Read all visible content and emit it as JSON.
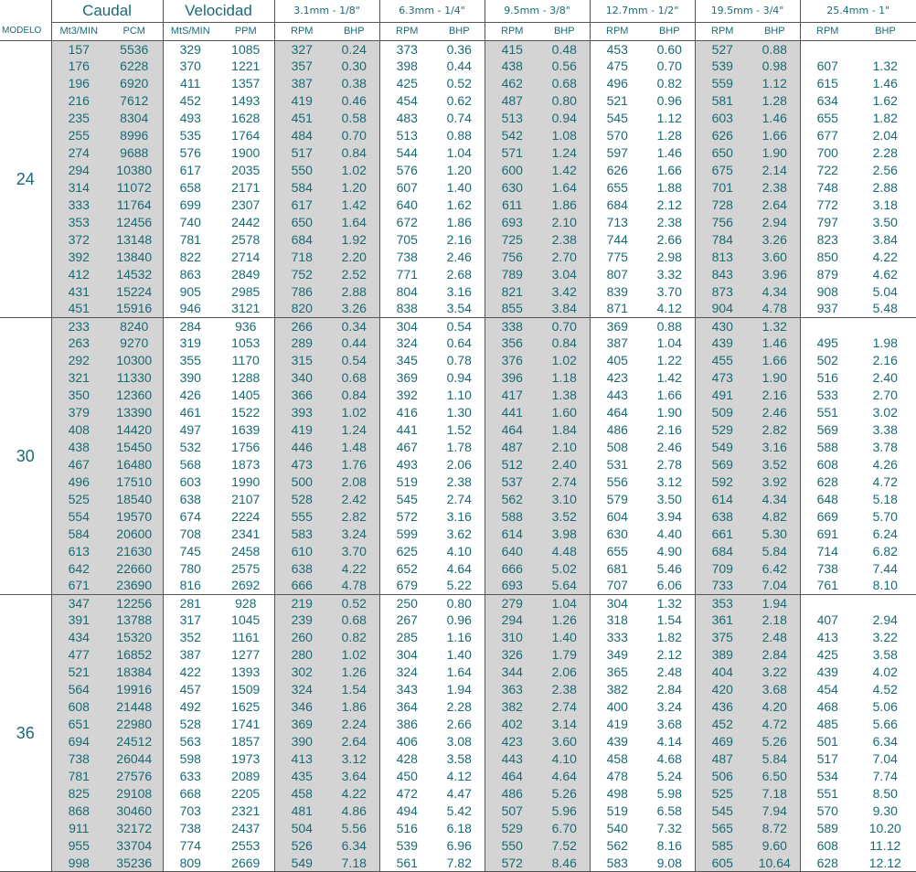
{
  "header": {
    "groups": [
      "Caudal",
      "Velocidad",
      "3.1mm - 1/8\"",
      "6.3mm - 1/4\"",
      "9.5mm - 3/8\"",
      "12.7mm - 1/2\"",
      "19.5mm - 3/4\"",
      "25.4mm - 1\""
    ],
    "modelo_label": "MODELO",
    "subheaders": [
      "Mt3/MIN",
      "PCM",
      "MtS/MIN",
      "PPM",
      "RPM",
      "BHP",
      "RPM",
      "BHP",
      "RPM",
      "BHP",
      "RPM",
      "BHP",
      "RPM",
      "BHP",
      "RPM",
      "BHP"
    ]
  },
  "models": [
    {
      "label": "24",
      "rows": [
        [
          "157",
          "5536",
          "329",
          "1085",
          "327",
          "0.24",
          "373",
          "0.36",
          "415",
          "0.48",
          "453",
          "0.60",
          "527",
          "0.88",
          "",
          ""
        ],
        [
          "176",
          "6228",
          "370",
          "1221",
          "357",
          "0.30",
          "398",
          "0.44",
          "438",
          "0.56",
          "475",
          "0.70",
          "539",
          "0.98",
          "607",
          "1.32"
        ],
        [
          "196",
          "6920",
          "411",
          "1357",
          "387",
          "0.38",
          "425",
          "0.52",
          "462",
          "0.68",
          "496",
          "0.82",
          "559",
          "1.12",
          "615",
          "1.46"
        ],
        [
          "216",
          "7612",
          "452",
          "1493",
          "419",
          "0.46",
          "454",
          "0.62",
          "487",
          "0.80",
          "521",
          "0.96",
          "581",
          "1.28",
          "634",
          "1.62"
        ],
        [
          "235",
          "8304",
          "493",
          "1628",
          "451",
          "0.58",
          "483",
          "0.74",
          "513",
          "0.94",
          "545",
          "1.12",
          "603",
          "1.46",
          "655",
          "1.82"
        ],
        [
          "255",
          "8996",
          "535",
          "1764",
          "484",
          "0.70",
          "513",
          "0.88",
          "542",
          "1.08",
          "570",
          "1.28",
          "626",
          "1.66",
          "677",
          "2.04"
        ],
        [
          "274",
          "9688",
          "576",
          "1900",
          "517",
          "0.84",
          "544",
          "1.04",
          "571",
          "1.24",
          "597",
          "1.46",
          "650",
          "1.90",
          "700",
          "2.28"
        ],
        [
          "294",
          "10380",
          "617",
          "2035",
          "550",
          "1.02",
          "576",
          "1.20",
          "600",
          "1.42",
          "626",
          "1.66",
          "675",
          "2.14",
          "722",
          "2.56"
        ],
        [
          "314",
          "11072",
          "658",
          "2171",
          "584",
          "1.20",
          "607",
          "1.40",
          "630",
          "1.64",
          "655",
          "1.88",
          "701",
          "2.38",
          "748",
          "2.88"
        ],
        [
          "333",
          "11764",
          "699",
          "2307",
          "617",
          "1.42",
          "640",
          "1.62",
          "611",
          "1.86",
          "684",
          "2.12",
          "728",
          "2.64",
          "772",
          "3.18"
        ],
        [
          "353",
          "12456",
          "740",
          "2442",
          "650",
          "1.64",
          "672",
          "1.86",
          "693",
          "2.10",
          "713",
          "2.38",
          "756",
          "2.94",
          "797",
          "3.50"
        ],
        [
          "372",
          "13148",
          "781",
          "2578",
          "684",
          "1.92",
          "705",
          "2.16",
          "725",
          "2.38",
          "744",
          "2.66",
          "784",
          "3.26",
          "823",
          "3.84"
        ],
        [
          "392",
          "13840",
          "822",
          "2714",
          "718",
          "2.20",
          "738",
          "2.46",
          "756",
          "2.70",
          "775",
          "2.98",
          "813",
          "3.60",
          "850",
          "4.22"
        ],
        [
          "412",
          "14532",
          "863",
          "2849",
          "752",
          "2.52",
          "771",
          "2.68",
          "789",
          "3.04",
          "807",
          "3.32",
          "843",
          "3.96",
          "879",
          "4.62"
        ],
        [
          "431",
          "15224",
          "905",
          "2985",
          "786",
          "2.88",
          "804",
          "3.16",
          "821",
          "3.42",
          "839",
          "3.70",
          "873",
          "4.34",
          "908",
          "5.04"
        ],
        [
          "451",
          "15916",
          "946",
          "3121",
          "820",
          "3.26",
          "838",
          "3.54",
          "855",
          "3.84",
          "871",
          "4.12",
          "904",
          "4.78",
          "937",
          "5.48"
        ]
      ]
    },
    {
      "label": "30",
      "rows": [
        [
          "233",
          "8240",
          "284",
          "936",
          "266",
          "0.34",
          "304",
          "0.54",
          "338",
          "0.70",
          "369",
          "0.88",
          "430",
          "1.32",
          "",
          ""
        ],
        [
          "263",
          "9270",
          "319",
          "1053",
          "289",
          "0.44",
          "324",
          "0.64",
          "356",
          "0.84",
          "387",
          "1.04",
          "439",
          "1.46",
          "495",
          "1.98"
        ],
        [
          "292",
          "10300",
          "355",
          "1170",
          "315",
          "0.54",
          "345",
          "0.78",
          "376",
          "1.02",
          "405",
          "1.22",
          "455",
          "1.66",
          "502",
          "2.16"
        ],
        [
          "321",
          "11330",
          "390",
          "1288",
          "340",
          "0.68",
          "369",
          "0.94",
          "396",
          "1.18",
          "423",
          "1.42",
          "473",
          "1.90",
          "516",
          "2.40"
        ],
        [
          "350",
          "12360",
          "426",
          "1405",
          "366",
          "0.84",
          "392",
          "1.10",
          "417",
          "1.38",
          "443",
          "1.66",
          "491",
          "2.16",
          "533",
          "2.70"
        ],
        [
          "379",
          "13390",
          "461",
          "1522",
          "393",
          "1.02",
          "416",
          "1.30",
          "441",
          "1.60",
          "464",
          "1.90",
          "509",
          "2.46",
          "551",
          "3.02"
        ],
        [
          "408",
          "14420",
          "497",
          "1639",
          "419",
          "1.24",
          "441",
          "1.52",
          "464",
          "1.84",
          "486",
          "2.16",
          "529",
          "2.82",
          "569",
          "3.38"
        ],
        [
          "438",
          "15450",
          "532",
          "1756",
          "446",
          "1.48",
          "467",
          "1.78",
          "487",
          "2.10",
          "508",
          "2.46",
          "549",
          "3.16",
          "588",
          "3.78"
        ],
        [
          "467",
          "16480",
          "568",
          "1873",
          "473",
          "1.76",
          "493",
          "2.06",
          "512",
          "2.40",
          "531",
          "2.78",
          "569",
          "3.52",
          "608",
          "4.26"
        ],
        [
          "496",
          "17510",
          "603",
          "1990",
          "500",
          "2.08",
          "519",
          "2.38",
          "537",
          "2.74",
          "556",
          "3.12",
          "592",
          "3.92",
          "628",
          "4.72"
        ],
        [
          "525",
          "18540",
          "638",
          "2107",
          "528",
          "2.42",
          "545",
          "2.74",
          "562",
          "3.10",
          "579",
          "3.50",
          "614",
          "4.34",
          "648",
          "5.18"
        ],
        [
          "554",
          "19570",
          "674",
          "2224",
          "555",
          "2.82",
          "572",
          "3.16",
          "588",
          "3.52",
          "604",
          "3.94",
          "638",
          "4.82",
          "669",
          "5.70"
        ],
        [
          "584",
          "20600",
          "708",
          "2341",
          "583",
          "3.24",
          "599",
          "3.62",
          "614",
          "3.98",
          "630",
          "4.40",
          "661",
          "5.30",
          "691",
          "6.24"
        ],
        [
          "613",
          "21630",
          "745",
          "2458",
          "610",
          "3.70",
          "625",
          "4.10",
          "640",
          "4.48",
          "655",
          "4.90",
          "684",
          "5.84",
          "714",
          "6.82"
        ],
        [
          "642",
          "22660",
          "780",
          "2575",
          "638",
          "4.22",
          "652",
          "4.64",
          "666",
          "5.02",
          "681",
          "5.46",
          "709",
          "6.42",
          "738",
          "7.44"
        ],
        [
          "671",
          "23690",
          "816",
          "2692",
          "666",
          "4.78",
          "679",
          "5.22",
          "693",
          "5.64",
          "707",
          "6.06",
          "733",
          "7.04",
          "761",
          "8.10"
        ]
      ]
    },
    {
      "label": "36",
      "rows": [
        [
          "347",
          "12256",
          "281",
          "928",
          "219",
          "0.52",
          "250",
          "0.80",
          "279",
          "1.04",
          "304",
          "1.32",
          "353",
          "1.94",
          "",
          ""
        ],
        [
          "391",
          "13788",
          "317",
          "1045",
          "239",
          "0.68",
          "267",
          "0.96",
          "294",
          "1.26",
          "318",
          "1.54",
          "361",
          "2.18",
          "407",
          "2.94"
        ],
        [
          "434",
          "15320",
          "352",
          "1161",
          "260",
          "0.82",
          "285",
          "1.16",
          "310",
          "1.40",
          "333",
          "1.82",
          "375",
          "2.48",
          "413",
          "3.22"
        ],
        [
          "477",
          "16852",
          "387",
          "1277",
          "280",
          "1.02",
          "304",
          "1.40",
          "326",
          "1.79",
          "349",
          "2.12",
          "389",
          "2.84",
          "425",
          "3.58"
        ],
        [
          "521",
          "18384",
          "422",
          "1393",
          "302",
          "1.26",
          "324",
          "1.64",
          "344",
          "2.06",
          "365",
          "2.48",
          "404",
          "3.22",
          "439",
          "4.02"
        ],
        [
          "564",
          "19916",
          "457",
          "1509",
          "324",
          "1.54",
          "343",
          "1.94",
          "363",
          "2.38",
          "382",
          "2.84",
          "420",
          "3.68",
          "454",
          "4.52"
        ],
        [
          "608",
          "21448",
          "492",
          "1625",
          "346",
          "1.86",
          "364",
          "2.28",
          "382",
          "2.74",
          "400",
          "3.24",
          "436",
          "4.20",
          "468",
          "5.06"
        ],
        [
          "651",
          "22980",
          "528",
          "1741",
          "369",
          "2.24",
          "386",
          "2.66",
          "402",
          "3.14",
          "419",
          "3.68",
          "452",
          "4.72",
          "485",
          "5.66"
        ],
        [
          "694",
          "24512",
          "563",
          "1857",
          "390",
          "2.64",
          "406",
          "3.08",
          "423",
          "3.60",
          "439",
          "4.14",
          "469",
          "5.26",
          "501",
          "6.34"
        ],
        [
          "738",
          "26044",
          "598",
          "1973",
          "413",
          "3.12",
          "428",
          "3.58",
          "443",
          "4.10",
          "458",
          "4.68",
          "487",
          "5.84",
          "517",
          "7.04"
        ],
        [
          "781",
          "27576",
          "633",
          "2089",
          "435",
          "3.64",
          "450",
          "4.12",
          "464",
          "4.64",
          "478",
          "5.24",
          "506",
          "6.50",
          "534",
          "7.74"
        ],
        [
          "825",
          "29108",
          "668",
          "2205",
          "458",
          "4.22",
          "472",
          "4.47",
          "486",
          "5.26",
          "498",
          "5.98",
          "525",
          "7.18",
          "551",
          "8.50"
        ],
        [
          "868",
          "30460",
          "703",
          "2321",
          "481",
          "4.86",
          "494",
          "5.42",
          "507",
          "5.96",
          "519",
          "6.58",
          "545",
          "7.94",
          "570",
          "9.30"
        ],
        [
          "911",
          "32172",
          "738",
          "2437",
          "504",
          "5.56",
          "516",
          "6.18",
          "529",
          "6.70",
          "540",
          "7.32",
          "565",
          "8.72",
          "589",
          "10.20"
        ],
        [
          "955",
          "33704",
          "774",
          "2553",
          "526",
          "6.34",
          "539",
          "6.96",
          "550",
          "7.52",
          "562",
          "8.16",
          "585",
          "9.60",
          "608",
          "11.12"
        ],
        [
          "998",
          "35236",
          "809",
          "2669",
          "549",
          "7.18",
          "561",
          "7.82",
          "572",
          "8.46",
          "583",
          "9.08",
          "605",
          "10.64",
          "628",
          "12.12"
        ]
      ]
    }
  ]
}
